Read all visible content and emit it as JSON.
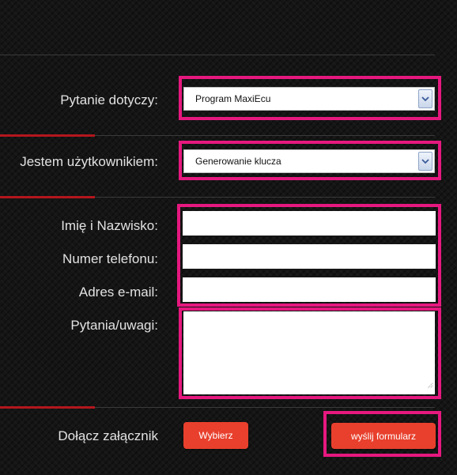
{
  "form": {
    "topic_label": "Pytanie dotyczy:",
    "topic_value": "Program MaxiEcu",
    "user_label": "Jestem użytkownikiem:",
    "user_value": "Generowanie klucza",
    "name_label": "Imię i Nazwisko:",
    "phone_label": "Numer telefonu:",
    "email_label": "Adres e-mail:",
    "comments_label": "Pytania/uwagi:",
    "attach_label": "Dołącz załącznik",
    "choose_button": "Wybierz",
    "submit_button": "wyślij formularz"
  },
  "colors": {
    "highlight": "#e6187f",
    "accent_red": "#e8402d",
    "divider_red": "#b3161d"
  },
  "icons": [
    "chevron-down-icon",
    "resize-grip-icon"
  ]
}
